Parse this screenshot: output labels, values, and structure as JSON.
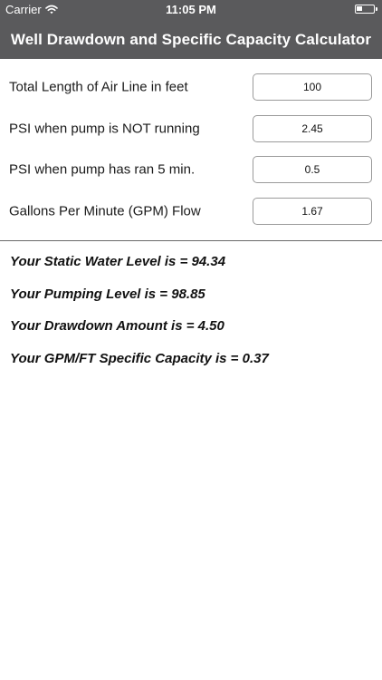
{
  "status_bar": {
    "carrier": "Carrier",
    "time": "11:05 PM"
  },
  "header": {
    "title": "Well Drawdown and Specific Capacity Calculator",
    "background_color": "#5a5a5c"
  },
  "inputs": [
    {
      "label": "Total Length of Air Line in feet",
      "value": "100"
    },
    {
      "label": "PSI when pump is NOT running",
      "value": "2.45"
    },
    {
      "label": "PSI when pump has ran 5 min.",
      "value": "0.5"
    },
    {
      "label": "Gallons Per Minute (GPM) Flow",
      "value": "1.67"
    }
  ],
  "results": [
    "Your Static Water Level is = 94.34",
    "Your Pumping Level is = 98.85",
    "Your Drawdown Amount is = 4.50",
    "Your GPM/FT Specific Capacity is = 0.37"
  ]
}
